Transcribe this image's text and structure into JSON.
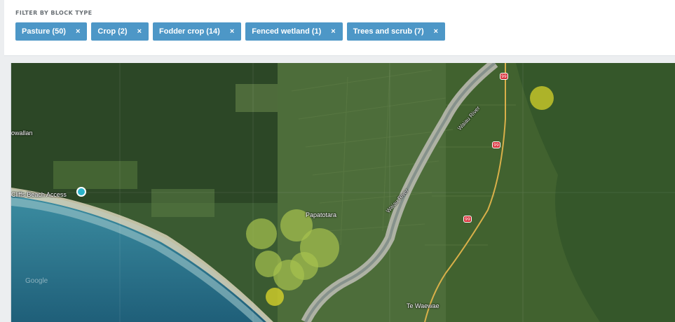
{
  "filter": {
    "heading": "FILTER BY BLOCK TYPE",
    "chips": [
      {
        "label": "Pasture (50)",
        "remove": "×"
      },
      {
        "label": "Crop (2)",
        "remove": "×"
      },
      {
        "label": "Fodder crop (14)",
        "remove": "×"
      },
      {
        "label": "Fenced wetland (1)",
        "remove": "×"
      },
      {
        "label": "Trees and scrub (7)",
        "remove": "×"
      }
    ]
  },
  "map": {
    "labels": {
      "place_left": "owallan",
      "beach_access": "Cliffs Beach Access",
      "papatotara": "Papatotara",
      "te_waewae": "Te Waewae",
      "river_upper": "Waiau River",
      "river_lower": "Waiau River",
      "watermark": "Google"
    },
    "road_badges": [
      "99",
      "99",
      "99"
    ],
    "colors": {
      "chip_bg": "#4d97c7",
      "pasture_marker": "#a6c24e",
      "fodder_marker": "#d6d12a",
      "pin": "#2bb3c9"
    }
  }
}
